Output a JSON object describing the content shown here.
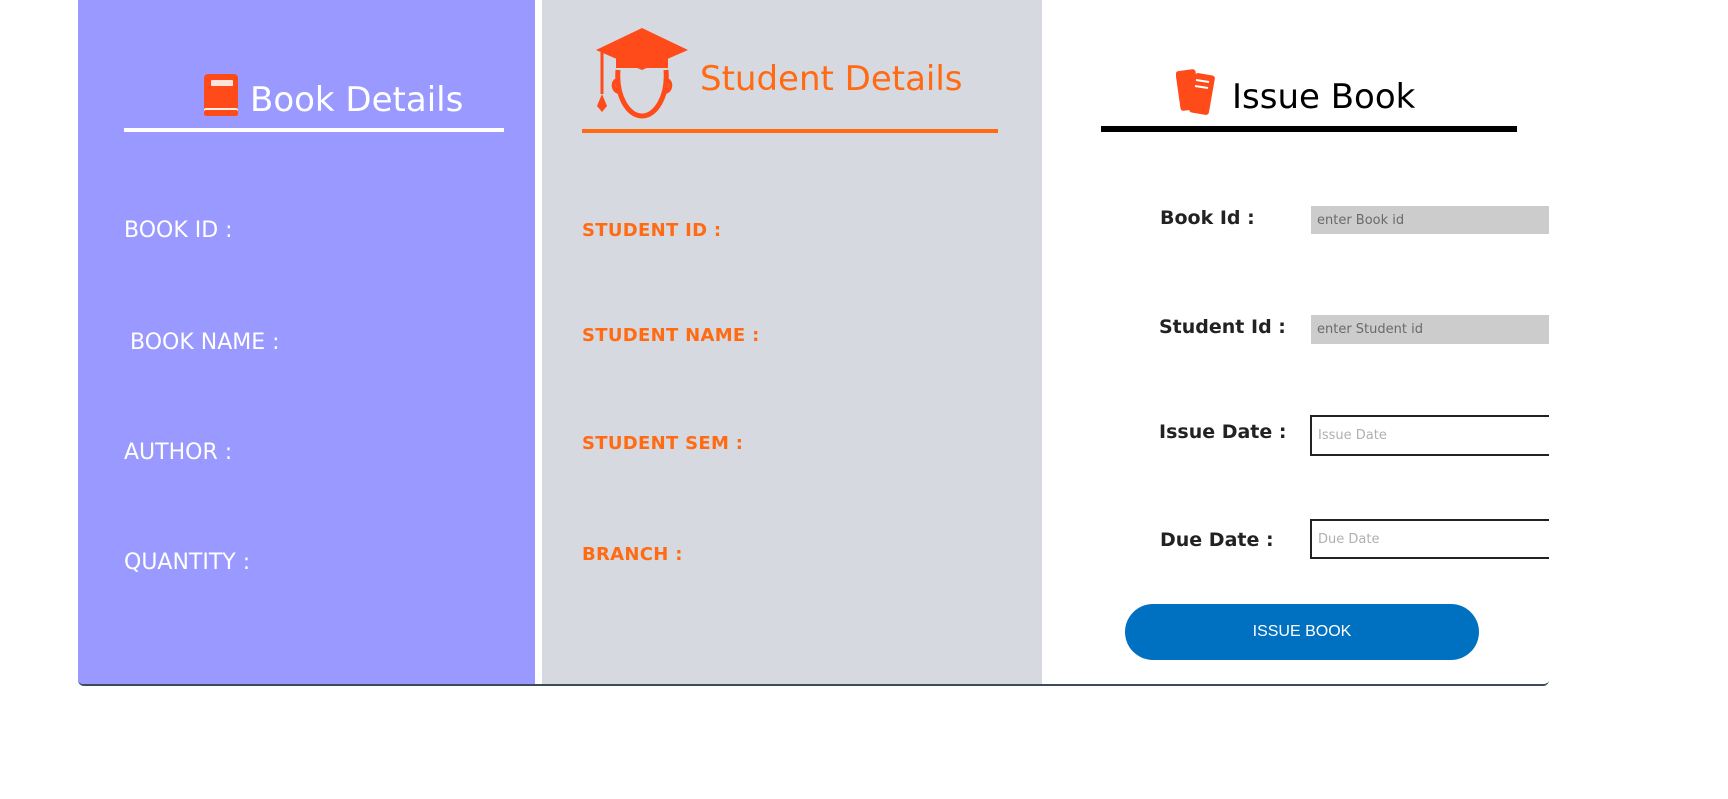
{
  "book_panel": {
    "title": "Book Details",
    "fields": [
      {
        "label": "BOOK ID :"
      },
      {
        "label": "BOOK NAME :"
      },
      {
        "label": "AUTHOR :"
      },
      {
        "label": "QUANTITY :"
      }
    ]
  },
  "student_panel": {
    "title": "Student Details",
    "fields": [
      {
        "label": "STUDENT ID :"
      },
      {
        "label": "STUDENT NAME :"
      },
      {
        "label": "STUDENT SEM :"
      },
      {
        "label": "BRANCH :"
      }
    ]
  },
  "issue_panel": {
    "title": "Issue Book",
    "book_id": {
      "label": "Book Id :",
      "placeholder": "enter Book id",
      "value": ""
    },
    "student_id": {
      "label": "Student Id :",
      "placeholder": "enter Student id",
      "value": ""
    },
    "issue_date": {
      "label": "Issue Date :",
      "placeholder": "Issue Date",
      "value": ""
    },
    "due_date": {
      "label": "Due Date :",
      "placeholder": "Due Date",
      "value": ""
    },
    "submit_label": "ISSUE BOOK"
  },
  "colors": {
    "book_panel_bg": "#9999ff",
    "student_panel_bg": "#d6d9e0",
    "accent_orange": "#ff6a13",
    "button_blue": "#0070c0"
  },
  "icons": {
    "book_panel": "book-icon",
    "student_panel": "graduate-icon",
    "issue_panel": "books-icon",
    "date_picker": "calendar-icon"
  }
}
